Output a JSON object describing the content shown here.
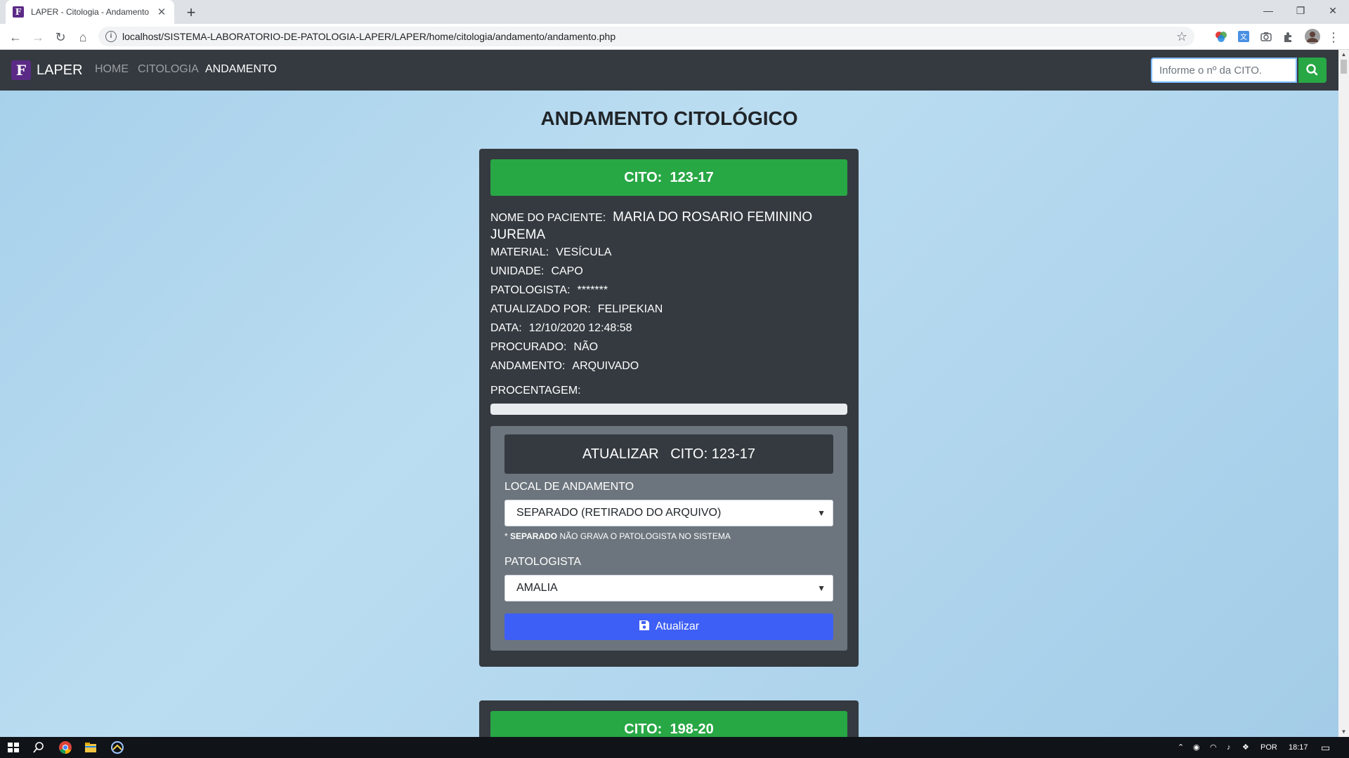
{
  "browser": {
    "tab_title": "LAPER - Citologia - Andamento",
    "favicon_letter": "F",
    "url": "localhost/SISTEMA-LABORATORIO-DE-PATOLOGIA-LAPER/LAPER/home/citologia/andamento/andamento.php"
  },
  "navbar": {
    "logo_letter": "F",
    "brand": "LAPER",
    "links": [
      "HOME",
      "CITOLOGIA",
      "ANDAMENTO"
    ],
    "active_link": "ANDAMENTO",
    "search_placeholder": "Informe o nº da CITO."
  },
  "page": {
    "title": "ANDAMENTO CITOLÓGICO"
  },
  "records": [
    {
      "header_label": "CITO:",
      "header_value": "123-17",
      "fields": [
        {
          "label": "NOME DO PACIENTE:",
          "value": "MARIA DO ROSARIO FEMININO JUREMA"
        },
        {
          "label": "MATERIAL:",
          "value": "VESÍCULA"
        },
        {
          "label": "UNIDADE:",
          "value": "CAPO"
        },
        {
          "label": "PATOLOGISTA:",
          "value": "*******"
        },
        {
          "label": "ATUALIZADO POR:",
          "value": "FELIPEKIAN"
        },
        {
          "label": "DATA:",
          "value": "12/10/2020 12:48:58"
        },
        {
          "label": "PROCURADO:",
          "value": "NÃO"
        },
        {
          "label": "ANDAMENTO:",
          "value": "ARQUIVADO"
        }
      ],
      "progress_label": "PROCENTAGEM:",
      "progress_fraction": 0.0,
      "update": {
        "title": "ATUALIZAR   CITO: 123-17",
        "local_label": "LOCAL DE ANDAMENTO",
        "local_selected": "SEPARADO (RETIRADO DO ARQUIVO)",
        "note_bold": "SEPARADO",
        "note_prefix": "* ",
        "note_rest": " NÃO GRAVA O PATOLOGISTA NO SISTEMA",
        "pathologist_label": "PATOLOGISTA",
        "pathologist_selected": "AMALIA",
        "button_label": "Atualizar"
      }
    },
    {
      "header_label": "CITO:",
      "header_value": "198-20"
    }
  ],
  "taskbar": {
    "language": "POR",
    "time": "18:17"
  },
  "colors": {
    "navbar": "#343a40",
    "success": "#28a745",
    "primary_button": "#3e5ff5",
    "card": "#343a40",
    "panel": "#6c757d"
  }
}
